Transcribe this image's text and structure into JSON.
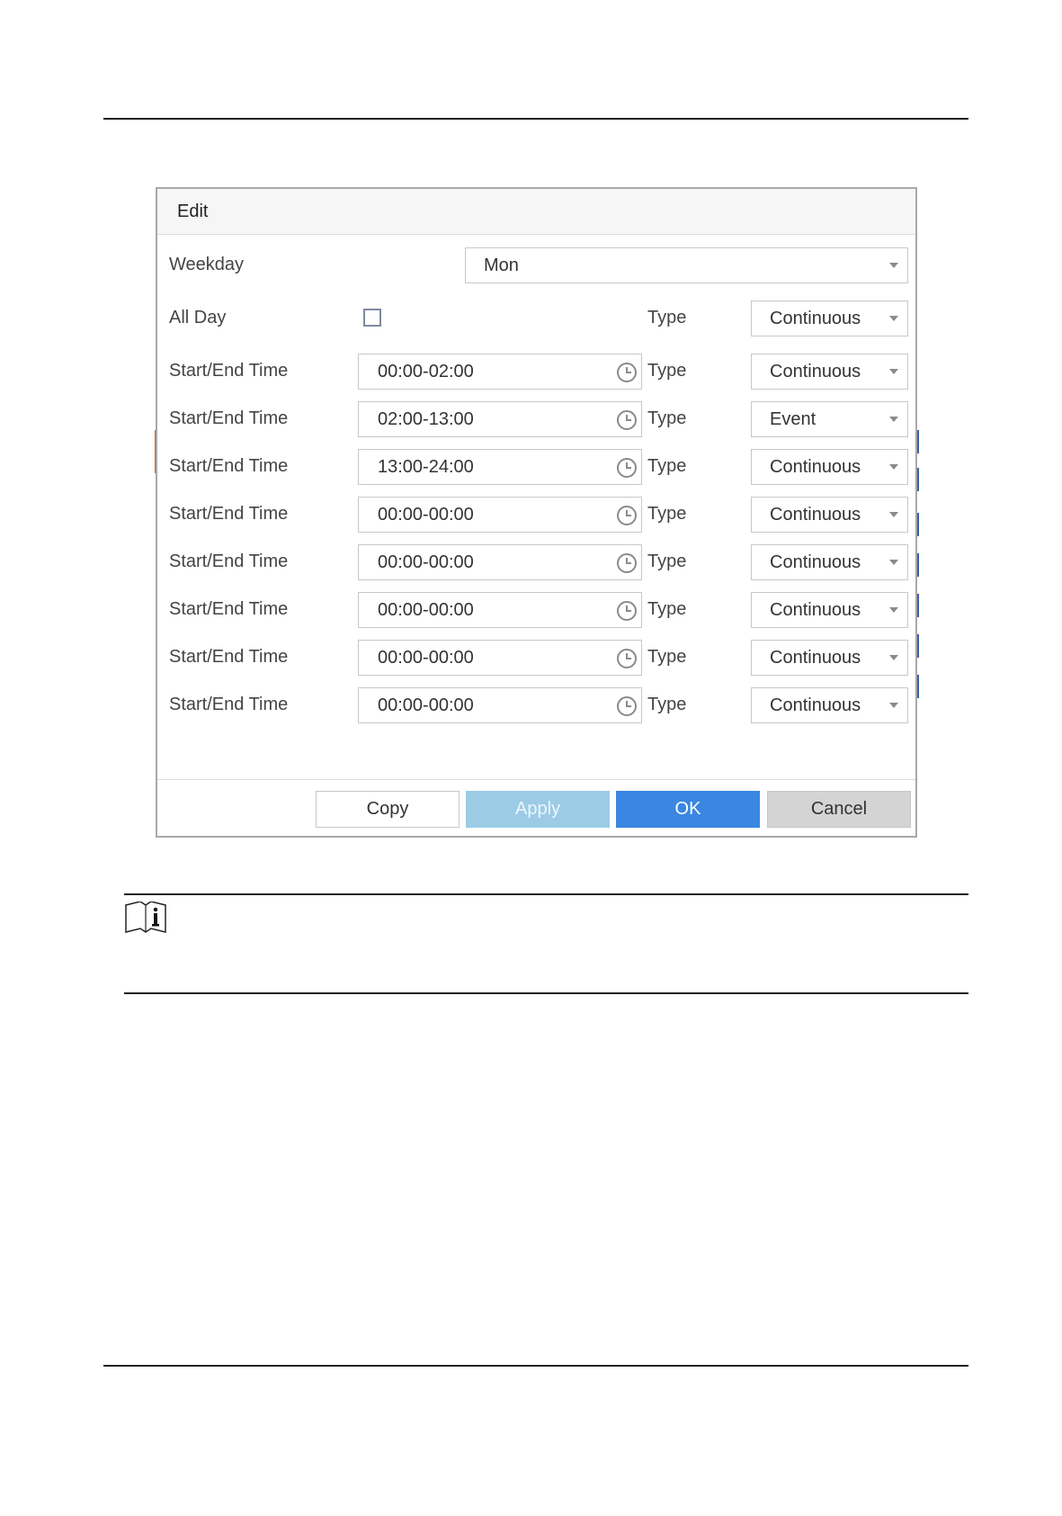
{
  "dialog": {
    "title": "Edit",
    "weekday": {
      "label": "Weekday",
      "value": "Mon"
    },
    "all_day": {
      "label": "All Day",
      "checked": false,
      "type_label": "Type",
      "type_value": "Continuous"
    },
    "rows": [
      {
        "label": "Start/End Time",
        "time": "00:00-02:00",
        "type_label": "Type",
        "type_value": "Continuous"
      },
      {
        "label": "Start/End Time",
        "time": "02:00-13:00",
        "type_label": "Type",
        "type_value": "Event"
      },
      {
        "label": "Start/End Time",
        "time": "13:00-24:00",
        "type_label": "Type",
        "type_value": "Continuous"
      },
      {
        "label": "Start/End Time",
        "time": "00:00-00:00",
        "type_label": "Type",
        "type_value": "Continuous"
      },
      {
        "label": "Start/End Time",
        "time": "00:00-00:00",
        "type_label": "Type",
        "type_value": "Continuous"
      },
      {
        "label": "Start/End Time",
        "time": "00:00-00:00",
        "type_label": "Type",
        "type_value": "Continuous"
      },
      {
        "label": "Start/End Time",
        "time": "00:00-00:00",
        "type_label": "Type",
        "type_value": "Continuous"
      },
      {
        "label": "Start/End Time",
        "time": "00:00-00:00",
        "type_label": "Type",
        "type_value": "Continuous"
      }
    ],
    "buttons": {
      "copy": "Copy",
      "apply": "Apply",
      "ok": "OK",
      "cancel": "Cancel"
    }
  },
  "colors": {
    "ok": "#3a86e0",
    "apply": "#9ccbe6",
    "cancel": "#d4d4d4"
  },
  "icons": {
    "note": "note-book-info-icon",
    "clock": "clock-icon",
    "caret": "caret-down-icon"
  }
}
